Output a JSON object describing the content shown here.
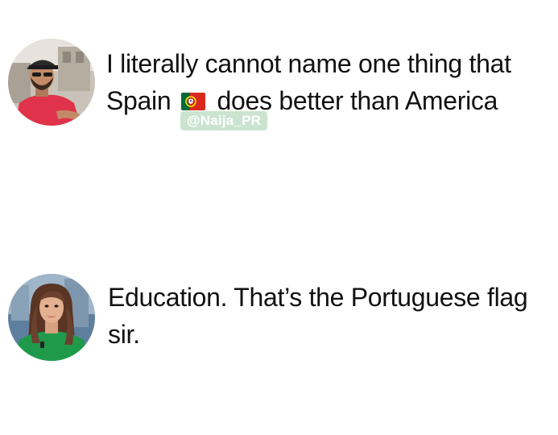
{
  "posts": [
    {
      "avatar_icon": "user-avatar-man-red-shirt",
      "line1": "I literally cannot name one thing that",
      "line2_before": "Spain",
      "flag_icon": "portugal-flag-icon",
      "line2_after": "does better than America"
    },
    {
      "avatar_icon": "user-avatar-woman-green-top",
      "line1": "Education. That’s the Portuguese flag",
      "line2": "sir."
    }
  ],
  "watermark": "@Naija_PR",
  "colors": {
    "background": "#ffffff",
    "text": "#111111",
    "flag_green": "#046a38",
    "flag_red": "#da291c",
    "flag_yellow": "#ffe900",
    "watermark_bg": "#a0cdaa"
  }
}
